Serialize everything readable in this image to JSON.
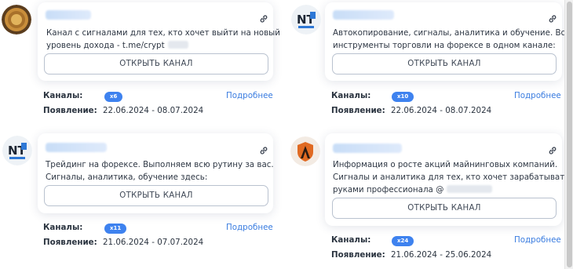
{
  "cards": [
    {
      "avatar": "gold-coin-logo",
      "description_lines": [
        "Канал с сигналами для тех, кто хочет выйти на новый",
        "уровень дохода - t.me/crypt"
      ],
      "button_label": "ОТКРЫТЬ КАНАЛ",
      "channels_label": "Каналы:",
      "channels_badge": "x6",
      "more_label": "Подробнее",
      "appearance_label": "Появление:",
      "appearance_dates": "22.06.2024 - 08.07.2024"
    },
    {
      "avatar": "nt-logo",
      "description_lines": [
        "Автокопирование, сигналы, аналитика и обучение. Все",
        "инструменты торговли на форексе в одном канале:"
      ],
      "button_label": "ОТКРЫТЬ КАНАЛ",
      "channels_label": "Каналы:",
      "channels_badge": "x10",
      "more_label": "Подробнее",
      "appearance_label": "Появление:",
      "appearance_dates": "22.06.2024 - 08.07.2024"
    },
    {
      "avatar": "nt-logo",
      "description_lines": [
        "Трейдинг на форексе. Выполняем всю рутину за вас.",
        "Сигналы, аналитика, обучение здесь:"
      ],
      "button_label": "ОТКРЫТЬ КАНАЛ",
      "channels_label": "Каналы:",
      "channels_badge": "x11",
      "more_label": "Подробнее",
      "appearance_label": "Появление:",
      "appearance_dates": "21.06.2024 - 07.07.2024"
    },
    {
      "avatar": "shield-a-logo",
      "description_lines": [
        "Информация о росте акций майнинговых компаний.",
        "Сигналы и аналитика для тех, кто хочет зарабатывать",
        "руками профессионала @"
      ],
      "button_label": "ОТКРЫТЬ КАНАЛ",
      "channels_label": "Каналы:",
      "channels_badge": "x24",
      "more_label": "Подробнее",
      "appearance_label": "Появление:",
      "appearance_dates": "21.06.2024 - 25.06.2024"
    }
  ],
  "icons": {
    "copy_link": "link-icon"
  },
  "colors": {
    "accent": "#3e82ef",
    "link": "#3b7de0",
    "text": "#2b3440"
  }
}
